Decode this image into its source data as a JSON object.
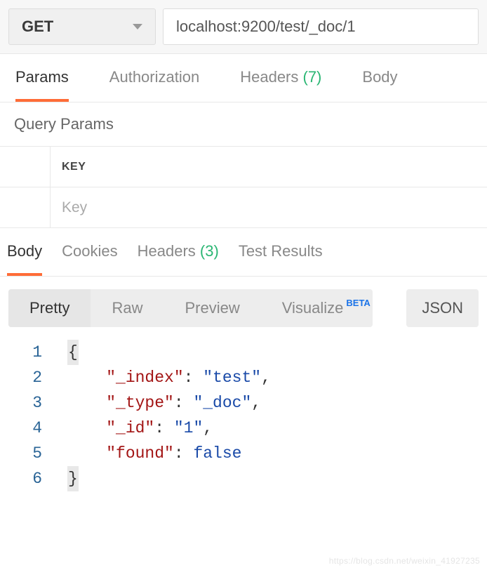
{
  "request": {
    "method": "GET",
    "url": "localhost:9200/test/_doc/1"
  },
  "requestTabs": {
    "params": "Params",
    "authorization": "Authorization",
    "headers": "Headers",
    "headersCount": "(7)",
    "body": "Body",
    "activeIndex": 0
  },
  "queryParams": {
    "sectionTitle": "Query Params",
    "keyHeader": "KEY",
    "keyPlaceholder": "Key"
  },
  "responseTabs": {
    "body": "Body",
    "cookies": "Cookies",
    "headers": "Headers",
    "headersCount": "(3)",
    "testResults": "Test Results",
    "activeIndex": 0
  },
  "viewTabs": {
    "pretty": "Pretty",
    "raw": "Raw",
    "preview": "Preview",
    "visualize": "Visualize",
    "betaBadge": "BETA",
    "formatLabel": "JSON"
  },
  "responseBody": {
    "lines": [
      {
        "n": "1",
        "tokens": [
          {
            "t": "brace-cursor",
            "v": "{"
          }
        ]
      },
      {
        "n": "2",
        "tokens": [
          {
            "t": "indent",
            "v": "    "
          },
          {
            "t": "key",
            "v": "\"_index\""
          },
          {
            "t": "cp",
            "v": ": "
          },
          {
            "t": "str",
            "v": "\"test\""
          },
          {
            "t": "cp",
            "v": ","
          }
        ]
      },
      {
        "n": "3",
        "tokens": [
          {
            "t": "indent",
            "v": "    "
          },
          {
            "t": "key",
            "v": "\"_type\""
          },
          {
            "t": "cp",
            "v": ": "
          },
          {
            "t": "str",
            "v": "\"_doc\""
          },
          {
            "t": "cp",
            "v": ","
          }
        ]
      },
      {
        "n": "4",
        "tokens": [
          {
            "t": "indent",
            "v": "    "
          },
          {
            "t": "key",
            "v": "\"_id\""
          },
          {
            "t": "cp",
            "v": ": "
          },
          {
            "t": "str",
            "v": "\"1\""
          },
          {
            "t": "cp",
            "v": ","
          }
        ]
      },
      {
        "n": "5",
        "tokens": [
          {
            "t": "indent",
            "v": "    "
          },
          {
            "t": "key",
            "v": "\"found\""
          },
          {
            "t": "cp",
            "v": ": "
          },
          {
            "t": "bool",
            "v": "false"
          }
        ]
      },
      {
        "n": "6",
        "tokens": [
          {
            "t": "brace-cursor",
            "v": "}"
          }
        ]
      }
    ]
  },
  "watermark": "https://blog.csdn.net/weixin_41927235"
}
